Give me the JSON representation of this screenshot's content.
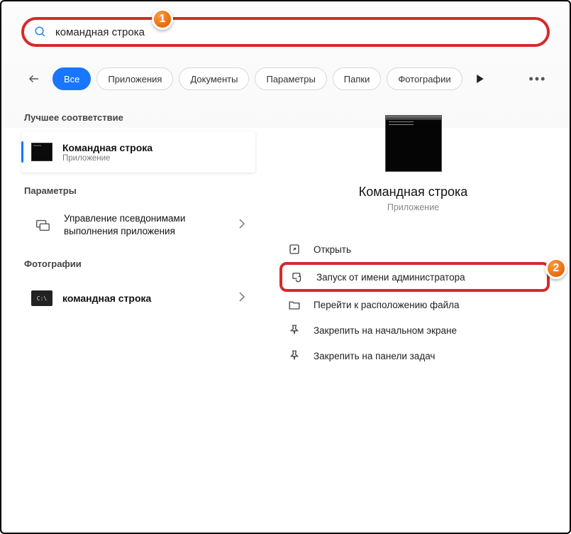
{
  "search": {
    "value": "командная строка"
  },
  "filters": {
    "back": "←",
    "all": "Все",
    "apps": "Приложения",
    "docs": "Документы",
    "params": "Параметры",
    "folders": "Папки",
    "photos": "Фотографии"
  },
  "sections": {
    "best": "Лучшее соответствие",
    "params": "Параметры",
    "photos": "Фотографии"
  },
  "results": {
    "best": {
      "title": "Командная строка",
      "sub": "Приложение"
    },
    "param1": {
      "title": "Управление псевдонимами выполнения приложения"
    },
    "photo1": {
      "title": "командная строка"
    }
  },
  "preview": {
    "title": "Командная строка",
    "sub": "Приложение"
  },
  "actions": {
    "open": "Открыть",
    "admin": "Запуск от имени администратора",
    "loc": "Перейти к расположению файла",
    "pinstart": "Закрепить на начальном экране",
    "pintask": "Закрепить на панели задач"
  },
  "badges": {
    "b1": "1",
    "b2": "2"
  }
}
